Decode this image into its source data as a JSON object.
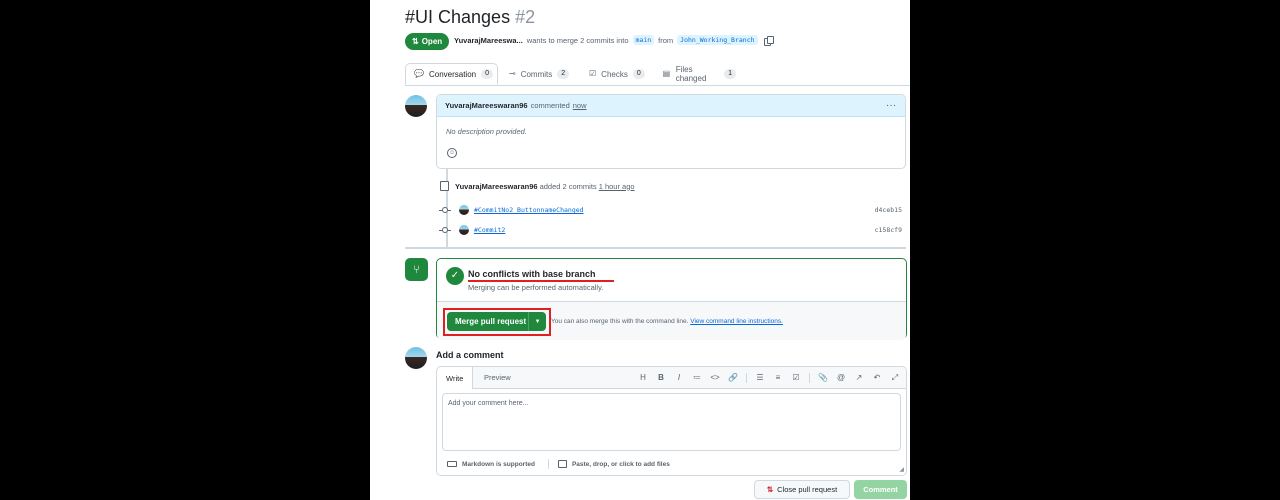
{
  "pr": {
    "title": "#UI Changes",
    "number": "#2",
    "state": "Open",
    "author": "YuvarajMareeswa...",
    "merge_text": "wants to merge 2 commits into",
    "base_branch": "main",
    "from_text": "from",
    "head_branch": "John_Working_Branch"
  },
  "tabs": [
    {
      "label": "Conversation",
      "count": "0",
      "icon": "comment-icon"
    },
    {
      "label": "Commits",
      "count": "2",
      "icon": "commit-icon"
    },
    {
      "label": "Checks",
      "count": "0",
      "icon": "checklist-icon"
    },
    {
      "label": "Files changed",
      "count": "1",
      "icon": "file-diff-icon"
    }
  ],
  "comment": {
    "author": "YuvarajMareeswaran96",
    "action": "commented",
    "time": "now",
    "body": "No description provided."
  },
  "commit_event": {
    "author": "YuvarajMareeswaran96",
    "action": "added 2 commits",
    "time": "1 hour ago"
  },
  "commits": [
    {
      "message": "#CommitNo2_ButtonnameChanged",
      "sha": "d4ceb15"
    },
    {
      "message": "#Commit2",
      "sha": "c158cf9"
    }
  ],
  "merge": {
    "title": "No conflicts with base branch",
    "subtitle": "Merging can be performed automatically.",
    "button": "Merge pull request",
    "cmd_text": "You can also merge this with the command line.",
    "cmd_link": "View command line instructions."
  },
  "add_comment": {
    "title": "Add a comment",
    "tab_write": "Write",
    "tab_preview": "Preview",
    "placeholder": "Add your comment here...",
    "markdown_note": "Markdown is supported",
    "attach_note": "Paste, drop, or click to add files"
  },
  "actions": {
    "close": "Close pull request",
    "comment": "Comment"
  },
  "colors": {
    "accent_green": "#1f883d",
    "link_blue": "#0969da",
    "annotation_red": "#e02020"
  }
}
